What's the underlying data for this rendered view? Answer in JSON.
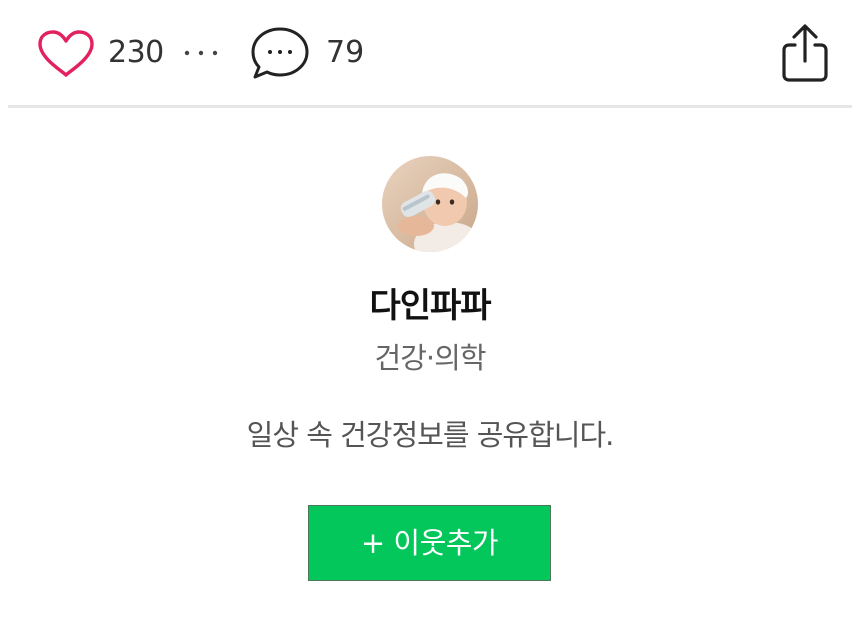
{
  "actions": {
    "like_count": "230",
    "comment_count": "79",
    "like_color": "#e3215f",
    "icons": {
      "like": "heart-icon",
      "more": "ellipsis-icon",
      "comment": "speech-bubble-icon",
      "share": "share-upload-icon"
    }
  },
  "profile": {
    "name": "다인파파",
    "category": "건강·의학",
    "description": "일상 속 건강정보를 공유합니다.",
    "add_button_label": "+ 이웃추가",
    "add_button_color": "#03c75a"
  }
}
